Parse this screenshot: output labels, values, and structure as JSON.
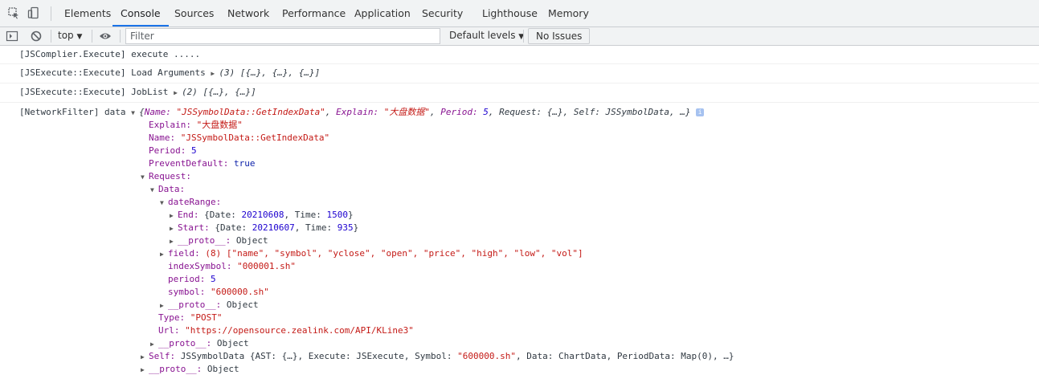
{
  "tabs": [
    "Elements",
    "Console",
    "Sources",
    "Network",
    "Performance",
    "Application",
    "Security",
    "Lighthouse",
    "Memory"
  ],
  "active_tab": "Console",
  "toolbar": {
    "context": "top",
    "filter_placeholder": "Filter",
    "levels": "Default levels",
    "issues": "No Issues"
  },
  "messages": [
    {
      "prefix": "[JSComplier.Execute] execute .....",
      "suffix": ""
    },
    {
      "prefix": "[JSExecute::Execute] Load Arguments",
      "suffix": "(3) [{…}, {…}, {…}]"
    },
    {
      "prefix": "[JSExecute::Execute] JobList",
      "suffix": "(2) [{…}, {…}]"
    }
  ],
  "network": {
    "prefix": "[NetworkFilter] data",
    "summary": {
      "name_key": "Name:",
      "name_val": "\"JSSymbolData::GetIndexData\"",
      "explain_key": "Explain:",
      "explain_val": "\"大盘数据\"",
      "period_key": "Period:",
      "period_val": "5",
      "rest": "Request: {…}, Self: JSSymbolData, …}"
    },
    "explain": {
      "k": "Explain:",
      "v": "\"大盘数据\""
    },
    "name": {
      "k": "Name:",
      "v": "\"JSSymbolData::GetIndexData\""
    },
    "period": {
      "k": "Period:",
      "v": "5"
    },
    "prevent": {
      "k": "PreventDefault:",
      "v": "true"
    },
    "request": "Request:",
    "data": "Data:",
    "daterange": "dateRange:",
    "end": {
      "k": "End:",
      "a": "{Date: ",
      "d": "20210608",
      "b": ", Time: ",
      "t": "1500",
      "c": "}"
    },
    "start": {
      "k": "Start:",
      "a": "{Date: ",
      "d": "20210607",
      "b": ", Time: ",
      "t": "935",
      "c": "}"
    },
    "proto": {
      "k": "__proto__:",
      "v": "Object"
    },
    "field": {
      "k": "field:",
      "v": "(8) [\"name\", \"symbol\", \"yclose\", \"open\", \"price\", \"high\", \"low\", \"vol\"]"
    },
    "indexsymbol": {
      "k": "indexSymbol:",
      "v": "\"000001.sh\""
    },
    "dperiod": {
      "k": "period:",
      "v": "5"
    },
    "symbol": {
      "k": "symbol:",
      "v": "\"600000.sh\""
    },
    "type": {
      "k": "Type:",
      "v": "\"POST\""
    },
    "url": {
      "k": "Url:",
      "v": "\"https://opensource.zealink.com/API/KLine3\""
    },
    "self": {
      "k": "Self:",
      "a": "JSSymbolData {AST: {…}, Execute: JSExecute, Symbol: ",
      "s": "\"600000.sh\"",
      "b": ", Data: ChartData, PeriodData: Map(0), …}"
    }
  }
}
